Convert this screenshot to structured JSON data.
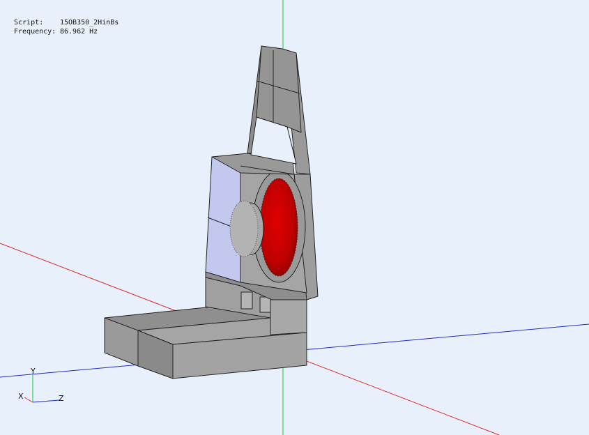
{
  "info": {
    "script_label": "Script:",
    "script_value": "15OB350_2HinBs",
    "frequency_label": "Frequency:",
    "frequency_value": "86.962 Hz"
  },
  "triad": {
    "y": "Y",
    "x": "X",
    "z": "Z"
  },
  "colors": {
    "background": "#e8f1fb",
    "axis_x": "#e0262b",
    "axis_y": "#19c63a",
    "axis_z": "#1a2bd0",
    "panel_gray": "#9a9a9a",
    "glass_panel": "#c3c8ef",
    "driver_red": "#cc0000"
  },
  "icons": [
    "orientation-triad-icon"
  ]
}
